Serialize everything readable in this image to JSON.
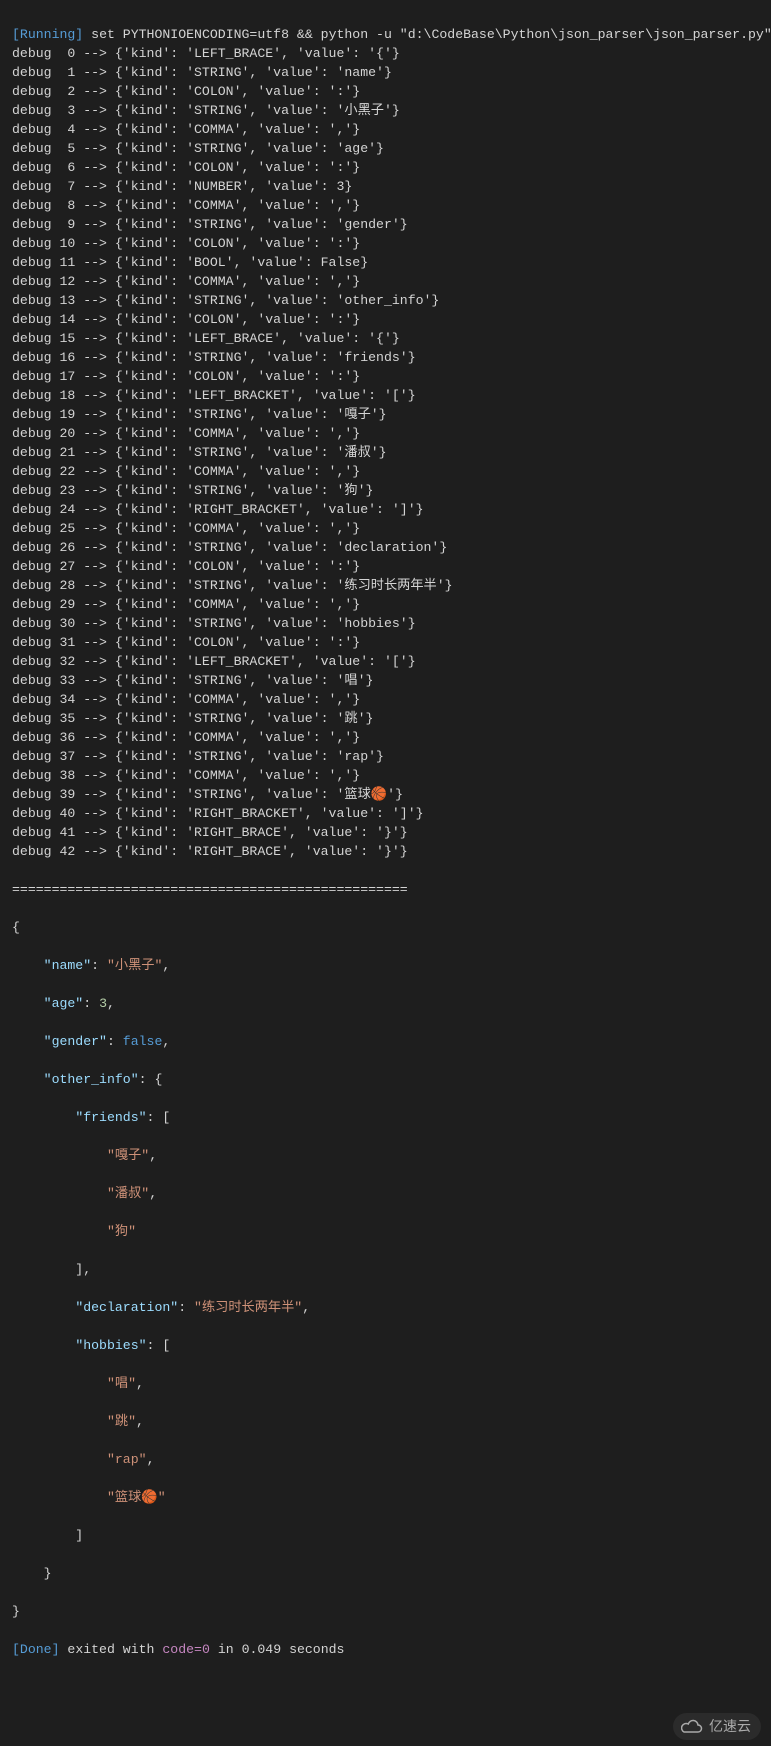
{
  "header": {
    "running_tag": "[Running]",
    "command": "set PYTHONIOENCODING=utf8 && python -u \"d:\\CodeBase\\Python\\json_parser\\json_parser.py\""
  },
  "debug_prefix": "debug",
  "arrow": "-->",
  "tokens": [
    {
      "i": 0,
      "kind": "LEFT_BRACE",
      "value": "'{'"
    },
    {
      "i": 1,
      "kind": "STRING",
      "value": "'name'"
    },
    {
      "i": 2,
      "kind": "COLON",
      "value": "':'"
    },
    {
      "i": 3,
      "kind": "STRING",
      "value": "'小黑子'"
    },
    {
      "i": 4,
      "kind": "COMMA",
      "value": "','"
    },
    {
      "i": 5,
      "kind": "STRING",
      "value": "'age'"
    },
    {
      "i": 6,
      "kind": "COLON",
      "value": "':'"
    },
    {
      "i": 7,
      "kind": "NUMBER",
      "value": "3"
    },
    {
      "i": 8,
      "kind": "COMMA",
      "value": "','"
    },
    {
      "i": 9,
      "kind": "STRING",
      "value": "'gender'"
    },
    {
      "i": 10,
      "kind": "COLON",
      "value": "':'"
    },
    {
      "i": 11,
      "kind": "BOOL",
      "value": "False"
    },
    {
      "i": 12,
      "kind": "COMMA",
      "value": "','"
    },
    {
      "i": 13,
      "kind": "STRING",
      "value": "'other_info'"
    },
    {
      "i": 14,
      "kind": "COLON",
      "value": "':'"
    },
    {
      "i": 15,
      "kind": "LEFT_BRACE",
      "value": "'{'"
    },
    {
      "i": 16,
      "kind": "STRING",
      "value": "'friends'"
    },
    {
      "i": 17,
      "kind": "COLON",
      "value": "':'"
    },
    {
      "i": 18,
      "kind": "LEFT_BRACKET",
      "value": "'['"
    },
    {
      "i": 19,
      "kind": "STRING",
      "value": "'嘎子'"
    },
    {
      "i": 20,
      "kind": "COMMA",
      "value": "','"
    },
    {
      "i": 21,
      "kind": "STRING",
      "value": "'潘叔'"
    },
    {
      "i": 22,
      "kind": "COMMA",
      "value": "','"
    },
    {
      "i": 23,
      "kind": "STRING",
      "value": "'狗'"
    },
    {
      "i": 24,
      "kind": "RIGHT_BRACKET",
      "value": "']'"
    },
    {
      "i": 25,
      "kind": "COMMA",
      "value": "','"
    },
    {
      "i": 26,
      "kind": "STRING",
      "value": "'declaration'"
    },
    {
      "i": 27,
      "kind": "COLON",
      "value": "':'"
    },
    {
      "i": 28,
      "kind": "STRING",
      "value": "'练习时长两年半'"
    },
    {
      "i": 29,
      "kind": "COMMA",
      "value": "','"
    },
    {
      "i": 30,
      "kind": "STRING",
      "value": "'hobbies'"
    },
    {
      "i": 31,
      "kind": "COLON",
      "value": "':'"
    },
    {
      "i": 32,
      "kind": "LEFT_BRACKET",
      "value": "'['"
    },
    {
      "i": 33,
      "kind": "STRING",
      "value": "'唱'"
    },
    {
      "i": 34,
      "kind": "COMMA",
      "value": "','"
    },
    {
      "i": 35,
      "kind": "STRING",
      "value": "'跳'"
    },
    {
      "i": 36,
      "kind": "COMMA",
      "value": "','"
    },
    {
      "i": 37,
      "kind": "STRING",
      "value": "'rap'"
    },
    {
      "i": 38,
      "kind": "COMMA",
      "value": "','"
    },
    {
      "i": 39,
      "kind": "STRING",
      "value": "'篮球🏀'"
    },
    {
      "i": 40,
      "kind": "RIGHT_BRACKET",
      "value": "']'"
    },
    {
      "i": 41,
      "kind": "RIGHT_BRACE",
      "value": "'}'"
    },
    {
      "i": 42,
      "kind": "RIGHT_BRACE",
      "value": "'}'"
    }
  ],
  "sep": "==================================================",
  "json_output": {
    "name": "小黑子",
    "age": 3,
    "gender_false": "false",
    "other_info": {
      "friends": [
        "嘎子",
        "潘叔",
        "狗"
      ],
      "declaration": "练习时长两年半",
      "hobbies": [
        "唱",
        "跳",
        "rap",
        "篮球🏀"
      ]
    }
  },
  "footer": {
    "done_tag": "[Done]",
    "exited_with": "exited with",
    "code_label": "code=",
    "code_value": "0",
    "in_label": "in",
    "time_value": "0.049",
    "seconds": "seconds"
  },
  "watermark": "亿速云"
}
